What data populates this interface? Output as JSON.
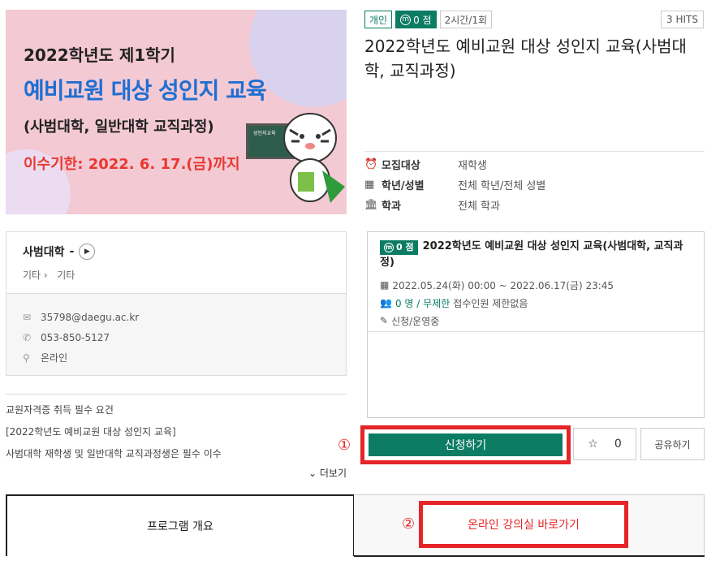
{
  "banner": {
    "line1": "2022학년도 제1학기",
    "line2": "예비교원 대상 성인지 교육",
    "line3": "(사범대학, 일반대학 교직과정)",
    "line4": "이수기한: 2022. 6. 17.(금)까지",
    "board_text": "성인지교육"
  },
  "tags": [
    "개인",
    "0 점",
    "2시간/1회"
  ],
  "hits": "3 HITS",
  "title": "2022학년도 예비교원 대상 성인지 교육(사범대학, 교직과정)",
  "info": [
    {
      "icon": "alarm-icon",
      "label": "모집대상",
      "value": "재학생"
    },
    {
      "icon": "calendar-icon",
      "label": "학년/성별",
      "value": "전체 학년/전체 성별"
    },
    {
      "icon": "building-icon",
      "label": "학과",
      "value": "전체 학과"
    }
  ],
  "contact": {
    "org": "사범대학",
    "org_dash": "-",
    "category1": "기타",
    "category2": "기타",
    "email": "35798@daegu.ac.kr",
    "phone": "053-850-5127",
    "location": "온라인"
  },
  "description": [
    "교원자격증 취득 필수 요건",
    "[2022학년도 예비교원 대상 성인지 교육]",
    "사범대학 재학생 및 일반대학 교직과정생은 필수 이수"
  ],
  "more_label": "더보기",
  "session": {
    "points": "0 점",
    "title": "2022학년도 예비교원 대상 성인지 교육(사범대학, 교직과정)",
    "period": "2022.05.24(화) 00:00 ~ 2022.06.17(금) 23:45",
    "capacity_highlight": "0 명 / 무제한",
    "capacity_note": "접수인원 제한없음",
    "status": "신청/운영중"
  },
  "actions": {
    "marker1": "①",
    "apply_label": "신청하기",
    "star_count": "0",
    "share_label": "공유하기"
  },
  "tabs": {
    "tab1_label": "프로그램 개요",
    "marker2": "②",
    "online_label": "온라인 강의실 바로가기"
  },
  "colors": {
    "accent": "#0c7c63",
    "highlight": "#e52528"
  }
}
